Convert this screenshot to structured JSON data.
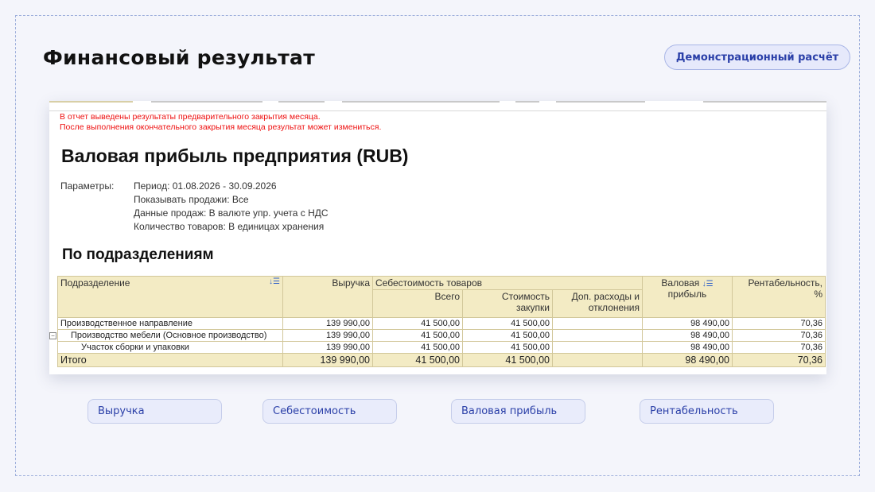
{
  "page": {
    "title": "Финансовый результат",
    "demo_badge": "Демонстрационный расчёт"
  },
  "report": {
    "warning_line1": "В отчет выведены результаты предварительного закрытия месяца.",
    "warning_line2": "После выполнения окончательного закрытия месяца результат может измениться.",
    "title": "Валовая прибыль предприятия (RUB)",
    "params_label": "Параметры:",
    "params": [
      "Период: 01.08.2026 - 30.09.2026",
      "Показывать продажи: Все",
      "Данные продаж: В валюте упр. учета с НДС",
      "Количество товаров: В единицах хранения"
    ],
    "section_title": "По подразделениям",
    "columns": {
      "division": "Подразделение",
      "revenue": "Выручка",
      "cost_group": "Себестоимость товаров",
      "cost_total": "Всего",
      "cost_purchase_line1": "Стоимость",
      "cost_purchase_line2": "закупки",
      "extra_line1": "Доп. расходы и",
      "extra_line2": "отклонения",
      "gross_line1": "Валовая",
      "gross_line2": "прибыль",
      "margin_line1": "Рентабельность,",
      "margin_line2": "%"
    },
    "rows": [
      {
        "name": "Производственное направление",
        "revenue": "139 990,00",
        "cost_total": "41 500,00",
        "cost_purchase": "41 500,00",
        "extra": "",
        "gross": "98 490,00",
        "margin": "70,36"
      },
      {
        "name": "Производство мебели (Основное производство)",
        "revenue": "139 990,00",
        "cost_total": "41 500,00",
        "cost_purchase": "41 500,00",
        "extra": "",
        "gross": "98 490,00",
        "margin": "70,36"
      },
      {
        "name": "Участок сборки и упаковки",
        "revenue": "139 990,00",
        "cost_total": "41 500,00",
        "cost_purchase": "41 500,00",
        "extra": "",
        "gross": "98 490,00",
        "margin": "70,36"
      }
    ],
    "total": {
      "name": "Итого",
      "revenue": "139 990,00",
      "cost_total": "41 500,00",
      "cost_purchase": "41 500,00",
      "extra": "",
      "gross": "98 490,00",
      "margin": "70,36"
    }
  },
  "tags": [
    "Выручка",
    "Себестоимость",
    "Валовая прибыль",
    "Рентабельность"
  ],
  "colors": {
    "accent": "#2a3fa8",
    "table_header": "#f3ebc4",
    "warning": "#ee1111"
  }
}
